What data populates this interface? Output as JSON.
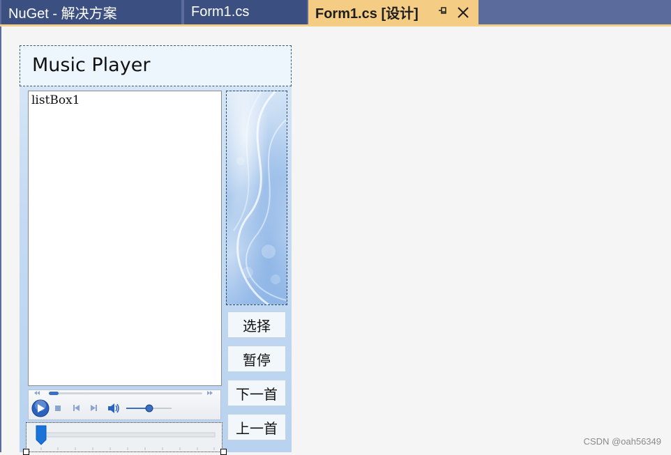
{
  "tabs": [
    {
      "label": "NuGet - 解决方案",
      "active": false
    },
    {
      "label": "Form1.cs",
      "active": false
    },
    {
      "label": "Form1.cs [设计]",
      "active": true
    }
  ],
  "tab_icons": {
    "pin": "pin-icon",
    "close": "close-icon"
  },
  "form": {
    "title": "Music Player",
    "listbox_text": "listBox1",
    "buttons": {
      "select": "选择",
      "pause": "暂停",
      "next": "下一首",
      "prev": "上一首"
    },
    "player_icons": [
      "rewind-icon",
      "forward-icon",
      "play-icon",
      "stop-icon",
      "previous-icon",
      "next-icon",
      "volume-icon"
    ]
  },
  "watermark": "CSDN @oah56349",
  "colors": {
    "tab_active": "#f5cc84",
    "tab_inactive": "#3b4f80",
    "tabbar": "#5b6b9b",
    "editor_bg": "#f5f5f5"
  }
}
